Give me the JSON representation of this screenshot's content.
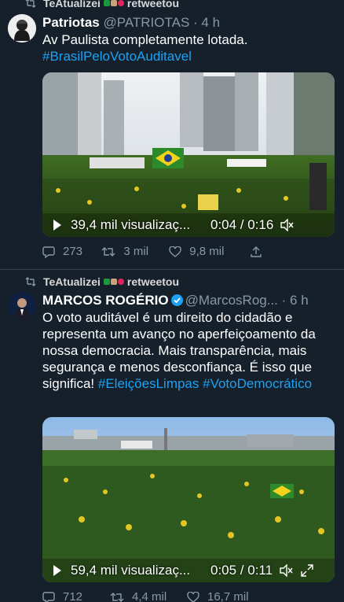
{
  "tweets": [
    {
      "retweeter": "TeAtualizei",
      "retweet_label": "retweetou",
      "name": "Patriotas",
      "handle": "@PATRIOTAS",
      "time": "· 4 h",
      "text": "Av Paulista completamente lotada.",
      "hashtags": [
        "#BrasilPeloVotoAuditavel"
      ],
      "video": {
        "views": "39,4 mil visualizaç...",
        "time": "0:04 / 0:16"
      },
      "actions": {
        "replies": "273",
        "retweets": "3 mil",
        "likes": "9,8 mil"
      }
    },
    {
      "retweeter": "TeAtualizei",
      "retweet_label": "retweetou",
      "name": "MARCOS ROGÉRIO",
      "handle": "@MarcosRog...",
      "time": "· 6 h",
      "text": "O voto auditável é um direito do cidadão e representa um avanço no aperfeiçoamento da  nossa democracia. Mais transparência, mais segurança e menos desconfiança. É isso que significa!",
      "hashtags": [
        "#EleiçõesLimpas",
        "#VotoDemocrático"
      ],
      "video": {
        "views": "59,4 mil visualizaç...",
        "time": "0:05 / 0:11"
      },
      "actions": {
        "replies": "712",
        "retweets": "4,4 mil",
        "likes": "16,7 mil"
      }
    }
  ],
  "colors": {
    "background": "#15202b",
    "accent": "#1da1f2",
    "muted": "#8899a6",
    "divider": "#38444d"
  },
  "icons": [
    "retweet-icon",
    "reply-icon",
    "like-icon",
    "share-icon",
    "play-icon",
    "mute-icon",
    "fullscreen-icon",
    "verified-icon"
  ]
}
